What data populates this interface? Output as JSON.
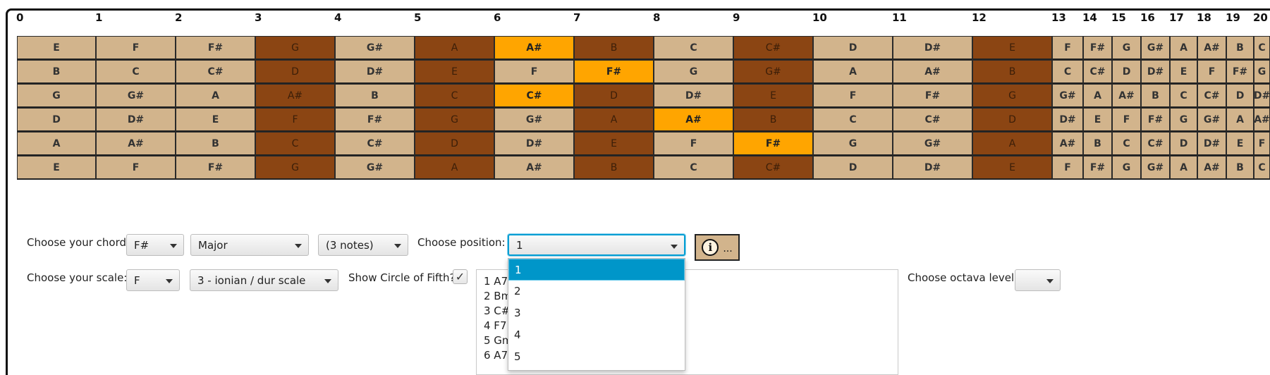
{
  "fret_numbers": [
    "0",
    "1",
    "2",
    "3",
    "4",
    "5",
    "6",
    "7",
    "8",
    "9",
    "10",
    "11",
    "12",
    "13",
    "14",
    "15",
    "16",
    "17",
    "18",
    "19",
    "20"
  ],
  "fretboard": {
    "strings": [
      [
        "E",
        "F",
        "F#",
        "G",
        "G#",
        "A",
        "A#",
        "B",
        "C",
        "C#",
        "D",
        "D#",
        "E",
        "F",
        "F#",
        "G",
        "G#",
        "A",
        "A#",
        "B",
        "C"
      ],
      [
        "B",
        "C",
        "C#",
        "D",
        "D#",
        "E",
        "F",
        "F#",
        "G",
        "G#",
        "A",
        "A#",
        "B",
        "C",
        "C#",
        "D",
        "D#",
        "E",
        "F",
        "F#",
        "G"
      ],
      [
        "G",
        "G#",
        "A",
        "A#",
        "B",
        "C",
        "C#",
        "D",
        "D#",
        "E",
        "F",
        "F#",
        "G",
        "G#",
        "A",
        "A#",
        "B",
        "C",
        "C#",
        "D",
        "D#"
      ],
      [
        "D",
        "D#",
        "E",
        "F",
        "F#",
        "G",
        "G#",
        "A",
        "A#",
        "B",
        "C",
        "C#",
        "D",
        "D#",
        "E",
        "F",
        "F#",
        "G",
        "G#",
        "A",
        "A#"
      ],
      [
        "A",
        "A#",
        "B",
        "C",
        "C#",
        "D",
        "D#",
        "E",
        "F",
        "F#",
        "G",
        "G#",
        "A",
        "A#",
        "B",
        "C",
        "C#",
        "D",
        "D#",
        "E",
        "F"
      ],
      [
        "E",
        "F",
        "F#",
        "G",
        "G#",
        "A",
        "A#",
        "B",
        "C",
        "C#",
        "D",
        "D#",
        "E",
        "F",
        "F#",
        "G",
        "G#",
        "A",
        "A#",
        "B",
        "C"
      ]
    ],
    "dark_frets": [
      3,
      5,
      7,
      9,
      12
    ],
    "highlighted": [
      [
        0,
        6
      ],
      [
        1,
        7
      ],
      [
        2,
        6
      ],
      [
        3,
        8
      ],
      [
        4,
        9
      ]
    ],
    "colors": {
      "light": "#d2b48c",
      "dark": "#8b4513",
      "highlight": "#ffa500"
    }
  },
  "controls": {
    "chord_label": "Choose your chord:",
    "chord_root": "F#",
    "chord_type": "Major",
    "chord_notes": "(3 notes)",
    "position_label": "Choose position:",
    "position_value": "1",
    "info_button_icon": "info-icon",
    "info_button_text": "...",
    "scale_label": "Choose your scale:",
    "scale_root": "F",
    "scale_mode": "3 - ionian / dur scale",
    "circle_label": "Show Circle of Fifth?",
    "circle_checked": "✓",
    "octave_label": "Choose octava level:",
    "octave_value": ""
  },
  "circle_list": [
    "1 A7",
    "2 Bm",
    "3 C#7",
    "4 F7",
    "5 Gm",
    "6 A7b"
  ],
  "position_dropdown": {
    "options": [
      "1",
      "2",
      "3",
      "4",
      "5"
    ],
    "selected": "1",
    "accent": "#0096c9"
  }
}
